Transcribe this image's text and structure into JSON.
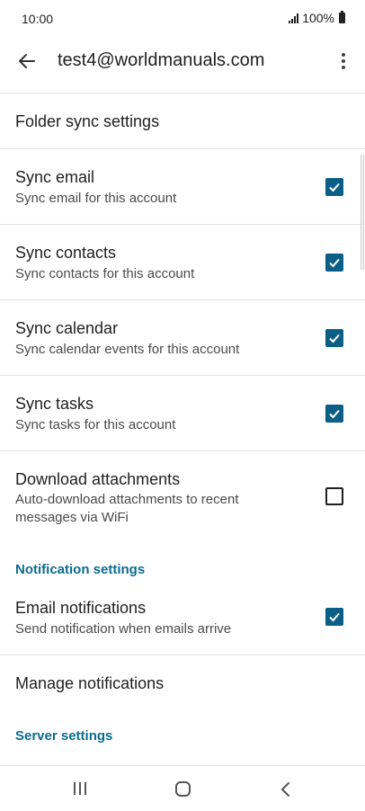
{
  "status_bar": {
    "time": "10:00",
    "battery": "100%"
  },
  "app_bar": {
    "title": "test4@worldmanuals.com"
  },
  "folder_sync": {
    "title": "Folder sync settings",
    "items": [
      {
        "title": "Sync email",
        "subtitle": "Sync email for this account",
        "checked": true
      },
      {
        "title": "Sync contacts",
        "subtitle": "Sync contacts for this account",
        "checked": true
      },
      {
        "title": "Sync calendar",
        "subtitle": "Sync calendar events for this account",
        "checked": true
      },
      {
        "title": "Sync tasks",
        "subtitle": "Sync tasks for this account",
        "checked": true
      },
      {
        "title": "Download attachments",
        "subtitle": "Auto-download attachments to recent messages via WiFi",
        "checked": false
      }
    ]
  },
  "notification_settings": {
    "header": "Notification settings",
    "email_notifications": {
      "title": "Email notifications",
      "subtitle": "Send notification when emails arrive",
      "checked": true
    },
    "manage": {
      "title": "Manage notifications"
    }
  },
  "server_settings": {
    "header": "Server settings"
  },
  "colors": {
    "accent": "#0b5e85",
    "category": "#0b6b8f"
  },
  "icons": {
    "back": "arrow-left-icon",
    "more": "more-vert-icon",
    "check": "check-icon"
  }
}
